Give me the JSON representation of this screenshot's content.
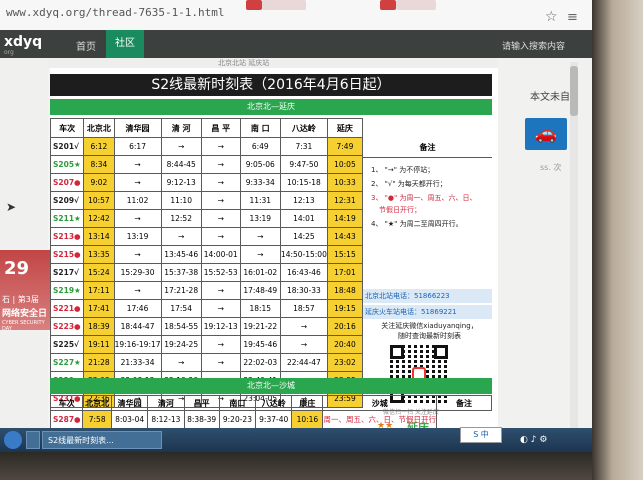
{
  "browser": {
    "url": "www.xdyq.org/thread-7635-1-1.html",
    "star_icon": "star-icon",
    "menu_icon": "menu-icon"
  },
  "nav": {
    "logo": "xdyq",
    "logo_sub": "org",
    "items": [
      {
        "label": "首页",
        "active": false
      },
      {
        "label": "社区",
        "active": true
      }
    ],
    "search_placeholder": "请输入搜索内容"
  },
  "post_bar": "北京北站 延庆站",
  "right_sidebar": {
    "text": "本文未自",
    "small": "ss. 次"
  },
  "left_ad": {
    "number": "29",
    "line1": "石 | 第3届",
    "line2": "网络安全日",
    "line3": "CYBER SECURITY DAY"
  },
  "timetable": {
    "title": "S2线最新时刻表（2016年4月6日起）",
    "section1": "北京北—延庆",
    "headers": [
      "车次",
      "北京北",
      "清华园",
      "清 河",
      "昌 平",
      "南 口",
      "八达岭",
      "延庆",
      "备注"
    ],
    "rows": [
      {
        "code": "S201√",
        "color": "black",
        "cells": [
          "6:12",
          "6:17",
          "→",
          "→",
          "6:49",
          "7:31",
          "7:49"
        ]
      },
      {
        "code": "S205★",
        "color": "green",
        "cells": [
          "8:34",
          "→",
          "8:44-45",
          "→",
          "9:05-06",
          "9:47-50",
          "10:05"
        ]
      },
      {
        "code": "S207●",
        "color": "red",
        "cells": [
          "9:02",
          "→",
          "9:12-13",
          "→",
          "9:33-34",
          "10:15-18",
          "10:33"
        ]
      },
      {
        "code": "S209√",
        "color": "black",
        "cells": [
          "10:57",
          "11:02",
          "11:10",
          "→",
          "11:31",
          "12:13",
          "12:31"
        ]
      },
      {
        "code": "S211★",
        "color": "green",
        "cells": [
          "12:42",
          "→",
          "12:52",
          "→",
          "13:19",
          "14:01",
          "14:19"
        ]
      },
      {
        "code": "S213●",
        "color": "red",
        "cells": [
          "13:14",
          "13:19",
          "→",
          "→",
          "→",
          "14:25",
          "14:43"
        ]
      },
      {
        "code": "S215●",
        "color": "red",
        "cells": [
          "13:35",
          "→",
          "13:45-46",
          "14:00-01",
          "→",
          "14:50-15:00",
          "15:15"
        ]
      },
      {
        "code": "S217√",
        "color": "black",
        "cells": [
          "15:24",
          "15:29-30",
          "15:37-38",
          "15:52-53",
          "16:01-02",
          "16:43-46",
          "17:01"
        ]
      },
      {
        "code": "S219★",
        "color": "green",
        "cells": [
          "17:11",
          "→",
          "17:21-28",
          "→",
          "17:48-49",
          "18:30-33",
          "18:48"
        ]
      },
      {
        "code": "S221●",
        "color": "red",
        "cells": [
          "17:41",
          "17:46",
          "17:54",
          "→",
          "18:15",
          "18:57",
          "19:15"
        ]
      },
      {
        "code": "S223●",
        "color": "red",
        "cells": [
          "18:39",
          "18:44-47",
          "18:54-55",
          "19:12-13",
          "19:21-22",
          "→",
          "20:16"
        ]
      },
      {
        "code": "S225√",
        "color": "black",
        "cells": [
          "19:11",
          "19:16-19:17",
          "19:24-25",
          "→",
          "19:45-46",
          "→",
          "20:40"
        ]
      },
      {
        "code": "S227★",
        "color": "green",
        "cells": [
          "21:28",
          "21:33-34",
          "→",
          "→",
          "22:02-03",
          "22:44-47",
          "23:02"
        ]
      },
      {
        "code": "S229●",
        "color": "red",
        "cells": [
          "22:03",
          "22:08-12",
          "22:19-20",
          "→",
          "22:40-41",
          "→",
          "23:35"
        ]
      },
      {
        "code": "S231●",
        "color": "red",
        "cells": [
          "22:36",
          "→",
          "→",
          "→",
          "23:04-05",
          "→",
          "23:59"
        ]
      }
    ],
    "notes": {
      "header": "备注",
      "items": [
        {
          "text": "1、 \"→\" 为不停站；",
          "red": false
        },
        {
          "text": "2、 \"√\" 为每天都开行；",
          "red": false
        },
        {
          "text": "3、 \"●\" 为周一、周五、六、日、",
          "red": true
        },
        {
          "text": "节假日开行；",
          "red": true
        },
        {
          "text": "4、 \"★\" 为周二至周四开行。",
          "red": false
        }
      ],
      "phone1": "北京北站电话：51866223",
      "phone2": "延庆火车站电话：51869221",
      "wechat1": "关注延庆微信xiaduyanqing，",
      "wechat2": "随时查询最新时刻表",
      "qr_caption": "微信扫一扫  关注延庆",
      "brand": "延庆",
      "brand_stars": "★★"
    },
    "section2": "北京北—沙城",
    "headers2": [
      "车次",
      "北京北",
      "清华园",
      "清河",
      "昌平",
      "南口",
      "八达岭",
      "康庄",
      "沙城",
      "备注"
    ],
    "rows2": [
      {
        "code": "S287●",
        "color": "red",
        "cells": [
          "7:58",
          "8:03-04",
          "8:12-13",
          "8:38-39",
          "9:20-23",
          "9:37-40",
          "10:16"
        ],
        "note": "周一、周五、六、日、节假日开行"
      }
    ]
  },
  "taskbar": {
    "tasks": [
      "S2线最新时刻表...",
      ""
    ],
    "sg_badge": "S 中"
  },
  "colors": {
    "nav_bg": "#3c403e",
    "nav_active": "#1a8b5e",
    "band_green": "#2aa64e",
    "highlight_yellow": "#f6cf31",
    "red": "#d2273b",
    "green": "#2c9b3a"
  }
}
